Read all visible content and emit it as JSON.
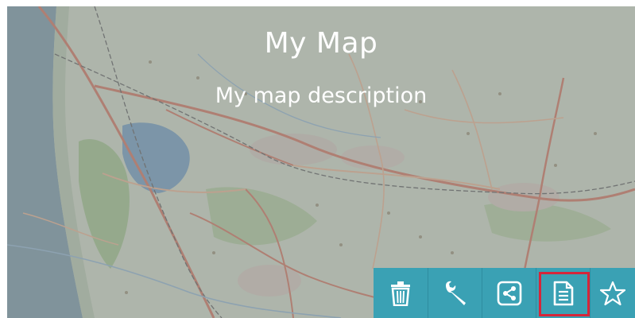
{
  "map": {
    "title": "My Map",
    "description": "My map description"
  },
  "toolbar": {
    "buttons": [
      {
        "name": "delete",
        "icon": "trash-icon",
        "label": "Delete",
        "highlighted": false
      },
      {
        "name": "settings",
        "icon": "wrench-icon",
        "label": "Settings",
        "highlighted": false
      },
      {
        "name": "share",
        "icon": "share-icon",
        "label": "Share",
        "highlighted": false
      },
      {
        "name": "details",
        "icon": "document-icon",
        "label": "Details",
        "highlighted": true
      },
      {
        "name": "favorite",
        "icon": "star-outline-icon",
        "label": "Favorite",
        "highlighted": false
      }
    ]
  },
  "colors": {
    "toolbar": "#3aa1b4",
    "highlight": "#d6263a",
    "text": "#ffffff"
  }
}
